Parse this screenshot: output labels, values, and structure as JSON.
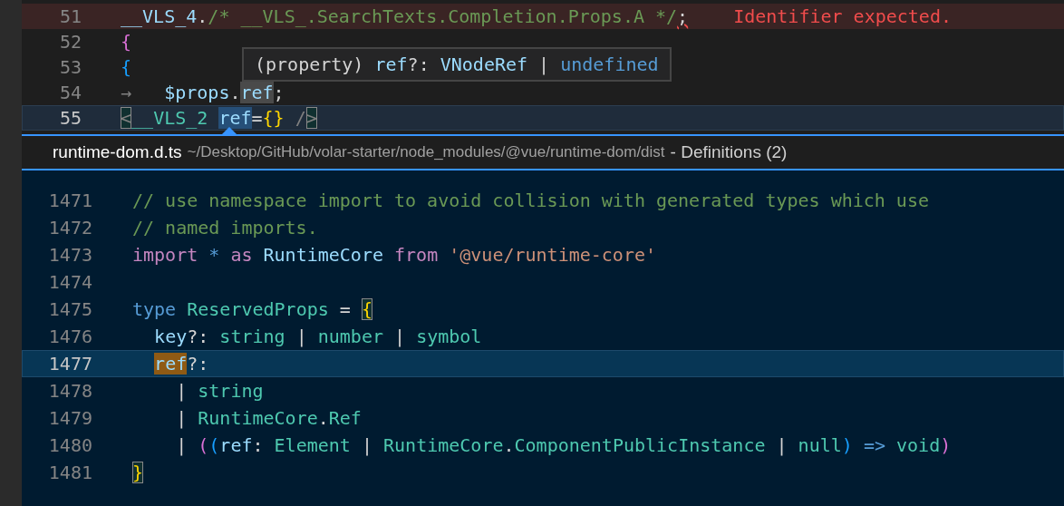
{
  "top_editor": {
    "lines": [
      {
        "number": "51",
        "current": false,
        "error": true,
        "tokens": [
          {
            "t": "__VLS_4",
            "kind": "variable"
          },
          {
            "t": ".",
            "kind": "punct"
          },
          {
            "t": "/* __VLS_.SearchTexts.Completion.Props.A */",
            "kind": "comment"
          },
          {
            "t": ";",
            "kind": "punct",
            "error": true
          }
        ],
        "diagnostic": "Identifier expected."
      },
      {
        "number": "52",
        "current": false,
        "error": false,
        "tokens": [
          {
            "t": "{",
            "kind": "bracket2"
          }
        ]
      },
      {
        "number": "53",
        "current": false,
        "error": false,
        "tokens": [
          {
            "t": "{",
            "kind": "bracket3"
          }
        ]
      },
      {
        "number": "54",
        "current": false,
        "error": false,
        "tokens": [
          {
            "t": "→",
            "kind": "whitespace"
          },
          {
            "t": "   $props",
            "kind": "variable"
          },
          {
            "t": ".",
            "kind": "punct"
          },
          {
            "t": "ref",
            "kind": "variable",
            "highlighted": true
          },
          {
            "t": ";",
            "kind": "punct"
          }
        ]
      },
      {
        "number": "55",
        "current": true,
        "error": false,
        "tokens": [
          {
            "t": "<",
            "kind": "whitespace",
            "matched": true
          },
          {
            "t": "__VLS_2",
            "kind": "type"
          },
          {
            "t": " ref",
            "kind": "variable",
            "selected": true
          },
          {
            "t": "=",
            "kind": "punct"
          },
          {
            "t": "{}",
            "kind": "bracket1"
          },
          {
            "t": " /",
            "kind": "whitespace"
          },
          {
            "t": ">",
            "kind": "whitespace",
            "matched": true
          }
        ]
      }
    ]
  },
  "hover": {
    "tokens": [
      {
        "t": "(property)",
        "kind": "punct"
      },
      {
        "t": " ref",
        "kind": "variable"
      },
      {
        "t": "?:",
        "kind": "punct"
      },
      {
        "t": " VNodeRef",
        "kind": "variable"
      },
      {
        "t": " |",
        "kind": "punct"
      },
      {
        "t": " undefined",
        "kind": "keyword"
      }
    ]
  },
  "peek": {
    "file": "runtime-dom.d.ts",
    "path": "~/Desktop/GitHub/volar-starter/node_modules/@vue/runtime-dom/dist",
    "label": "- Definitions (2)",
    "lines": [
      {
        "number": "1471",
        "current": false,
        "tokens": [
          {
            "t": "// use namespace import to avoid collision with generated types which use",
            "kind": "comment"
          }
        ]
      },
      {
        "number": "1472",
        "current": false,
        "tokens": [
          {
            "t": "// named imports.",
            "kind": "comment"
          }
        ]
      },
      {
        "number": "1473",
        "current": false,
        "tokens": [
          {
            "t": "import",
            "kind": "control"
          },
          {
            "t": " *",
            "kind": "keyword"
          },
          {
            "t": " as",
            "kind": "control"
          },
          {
            "t": " RuntimeCore",
            "kind": "variable"
          },
          {
            "t": " from",
            "kind": "control"
          },
          {
            "t": " '@vue/runtime-core'",
            "kind": "string"
          }
        ]
      },
      {
        "number": "1474",
        "current": false
      },
      {
        "number": "1475",
        "current": false,
        "tokens": [
          {
            "t": "type",
            "kind": "keyword"
          },
          {
            "t": " ReservedProps",
            "kind": "type"
          },
          {
            "t": " =",
            "kind": "punct"
          },
          {
            "t": " {",
            "kind": "bracket1",
            "matched": true
          }
        ]
      },
      {
        "number": "1476",
        "current": false,
        "tokens": [
          {
            "t": "  key",
            "kind": "variable"
          },
          {
            "t": "?:",
            "kind": "punct"
          },
          {
            "t": " string",
            "kind": "type"
          },
          {
            "t": " |",
            "kind": "punct"
          },
          {
            "t": " number",
            "kind": "type"
          },
          {
            "t": " |",
            "kind": "punct"
          },
          {
            "t": " symbol",
            "kind": "type"
          }
        ]
      },
      {
        "number": "1477",
        "current": true,
        "tokens": [
          {
            "t": "  ref",
            "kind": "variable",
            "highlighted": true
          },
          {
            "t": "?:",
            "kind": "punct"
          }
        ]
      },
      {
        "number": "1478",
        "current": false,
        "tokens": [
          {
            "t": "    |",
            "kind": "punct"
          },
          {
            "t": " string",
            "kind": "type"
          }
        ]
      },
      {
        "number": "1479",
        "current": false,
        "tokens": [
          {
            "t": "    |",
            "kind": "punct"
          },
          {
            "t": " RuntimeCore",
            "kind": "type"
          },
          {
            "t": ".",
            "kind": "punct"
          },
          {
            "t": "Ref",
            "kind": "type"
          }
        ]
      },
      {
        "number": "1480",
        "current": false,
        "tokens": [
          {
            "t": "    |",
            "kind": "punct"
          },
          {
            "t": " (",
            "kind": "bracket2"
          },
          {
            "t": "(",
            "kind": "bracket3"
          },
          {
            "t": "ref",
            "kind": "variable"
          },
          {
            "t": ":",
            "kind": "punct"
          },
          {
            "t": " Element",
            "kind": "type"
          },
          {
            "t": " |",
            "kind": "punct"
          },
          {
            "t": " RuntimeCore",
            "kind": "type"
          },
          {
            "t": ".",
            "kind": "punct"
          },
          {
            "t": "ComponentPublicInstance",
            "kind": "type"
          },
          {
            "t": " |",
            "kind": "punct"
          },
          {
            "t": " null",
            "kind": "type"
          },
          {
            "t": ")",
            "kind": "bracket3"
          },
          {
            "t": " =>",
            "kind": "keyword"
          },
          {
            "t": " void",
            "kind": "type"
          },
          {
            "t": ")",
            "kind": "bracket2"
          }
        ]
      },
      {
        "number": "1481",
        "current": false,
        "tokens": [
          {
            "t": "}",
            "kind": "bracket1",
            "matched": true
          }
        ]
      }
    ]
  }
}
